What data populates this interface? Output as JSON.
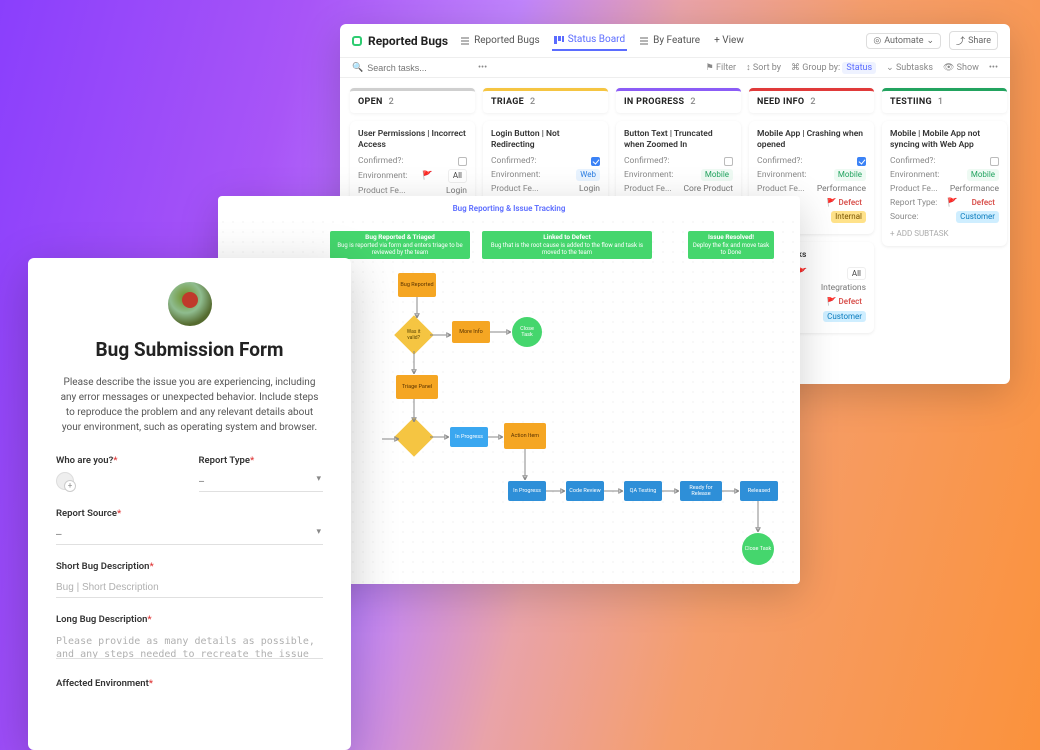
{
  "board": {
    "title": "Reported Bugs",
    "views": [
      {
        "label": "Reported Bugs",
        "active": false
      },
      {
        "label": "Status Board",
        "active": true
      },
      {
        "label": "By Feature",
        "active": false
      }
    ],
    "add_view": "+ View",
    "automate": "Automate",
    "share": "Share",
    "search_placeholder": "Search tasks...",
    "toolbar": {
      "filter": "Filter",
      "sort": "Sort by",
      "group_label": "Group by:",
      "group_value": "Status",
      "subtasks": "Subtasks",
      "show": "Show"
    },
    "columns": [
      {
        "name": "OPEN",
        "count": 2,
        "color": "#cfcfcf",
        "cards": [
          {
            "title": "User Permissions | Incorrect Access",
            "confirmed": false,
            "fields": [
              {
                "label": "Confirmed?:",
                "value": ""
              },
              {
                "label": "Environment:",
                "value": "All",
                "tag": "tag-all",
                "flag": "🚩"
              },
              {
                "label": "Product Fe...",
                "value": "Login"
              }
            ]
          }
        ]
      },
      {
        "name": "TRIAGE",
        "count": 2,
        "color": "#f5c542",
        "cards": [
          {
            "title": "Login Button | Not Redirecting",
            "confirmed": true,
            "fields": [
              {
                "label": "Confirmed?:",
                "value": "checked"
              },
              {
                "label": "Environment:",
                "value": "Web",
                "tag": "tag-web"
              },
              {
                "label": "Product Fe...",
                "value": "Login"
              }
            ]
          }
        ]
      },
      {
        "name": "IN PROGRESS",
        "count": 2,
        "color": "#8b5cf6",
        "cards": [
          {
            "title": "Button Text | Truncated when Zoomed In",
            "confirmed": false,
            "fields": [
              {
                "label": "Confirmed?:",
                "value": ""
              },
              {
                "label": "Environment:",
                "value": "Mobile",
                "tag": "tag-mobile"
              },
              {
                "label": "Product Fe...",
                "value": "Core Product"
              }
            ]
          }
        ]
      },
      {
        "name": "NEED INFO",
        "count": 2,
        "color": "#e03a3a",
        "cards": [
          {
            "title": "Mobile App | Crashing when opened",
            "confirmed": true,
            "fields": [
              {
                "label": "Confirmed?:",
                "value": "checked"
              },
              {
                "label": "Environment:",
                "value": "Mobile",
                "tag": "tag-mobile"
              },
              {
                "label": "Product Fe...",
                "value": "Performance"
              }
            ],
            "extra_tags": [
              {
                "text": "Defect",
                "cls": "tag-defect",
                "flag": "🚩"
              },
              {
                "text": "Internal",
                "cls": "tag-internal"
              }
            ]
          },
          {
            "title": "Broken Links",
            "fields": [
              {
                "label": "",
                "value": "All",
                "tag": "tag-all",
                "flag": "🚩"
              },
              {
                "label": "",
                "value": "Integrations"
              }
            ],
            "extra_tags": [
              {
                "text": "Defect",
                "cls": "tag-defect",
                "flag": "🚩"
              },
              {
                "text": "Customer",
                "cls": "tag-customer"
              }
            ]
          }
        ]
      },
      {
        "name": "TESTIING",
        "count": 1,
        "color": "#22a35f",
        "cards": [
          {
            "title": "Mobile | Mobile App not syncing with Web App",
            "confirmed": false,
            "fields": [
              {
                "label": "Confirmed?:",
                "value": ""
              },
              {
                "label": "Environment:",
                "value": "Mobile",
                "tag": "tag-mobile"
              },
              {
                "label": "Product Fe...",
                "value": "Performance"
              },
              {
                "label": "Report Type:",
                "value": "Defect",
                "tag": "tag-defect",
                "flag": "🚩"
              },
              {
                "label": "Source:",
                "value": "Customer",
                "tag": "tag-customer"
              }
            ],
            "add_subtask": "+ ADD SUBTASK"
          }
        ]
      }
    ]
  },
  "flow": {
    "title": "Bug Reporting & Issue Tracking",
    "lanes": [
      {
        "title": "Bug Reported & Triaged",
        "sub": "Bug is reported via form and enters triage to be reviewed by the team"
      },
      {
        "title": "Linked to Defect",
        "sub": "Bug that is the root cause is added to the flow and task is moved to the team"
      },
      {
        "title": "Issue Resolved!",
        "sub": "Deploy the fix and move task to Done"
      }
    ],
    "nodes": {
      "n1": "Bug Reported",
      "d1": "Was it valid?",
      "n2": "More Info",
      "c1": "Close Task",
      "n3": "Triage Panel",
      "d2": "",
      "n4": "In Progress",
      "n5": "Action Item",
      "n6": "In Progress",
      "n7": "Code Review",
      "n8": "QA Testing",
      "n9": "Ready for Release",
      "n10": "Released",
      "c2": "Close Task"
    }
  },
  "form": {
    "heading": "Bug Submission Form",
    "description": "Please describe the issue you are experiencing, including any error messages or unexpected behavior. Include steps to reproduce the problem and any relevant details about your environment, such as operating system and browser.",
    "fields": {
      "who": "Who are you?",
      "report_type": "Report Type",
      "report_source": "Report Source",
      "short_desc": "Short Bug Description",
      "short_desc_ph": "Bug | Short Description",
      "long_desc": "Long Bug Description",
      "long_desc_ph": "Please provide as many details as possible, and any steps needed to recreate the issue",
      "affected_env": "Affected Environment",
      "select_empty": "–"
    }
  }
}
